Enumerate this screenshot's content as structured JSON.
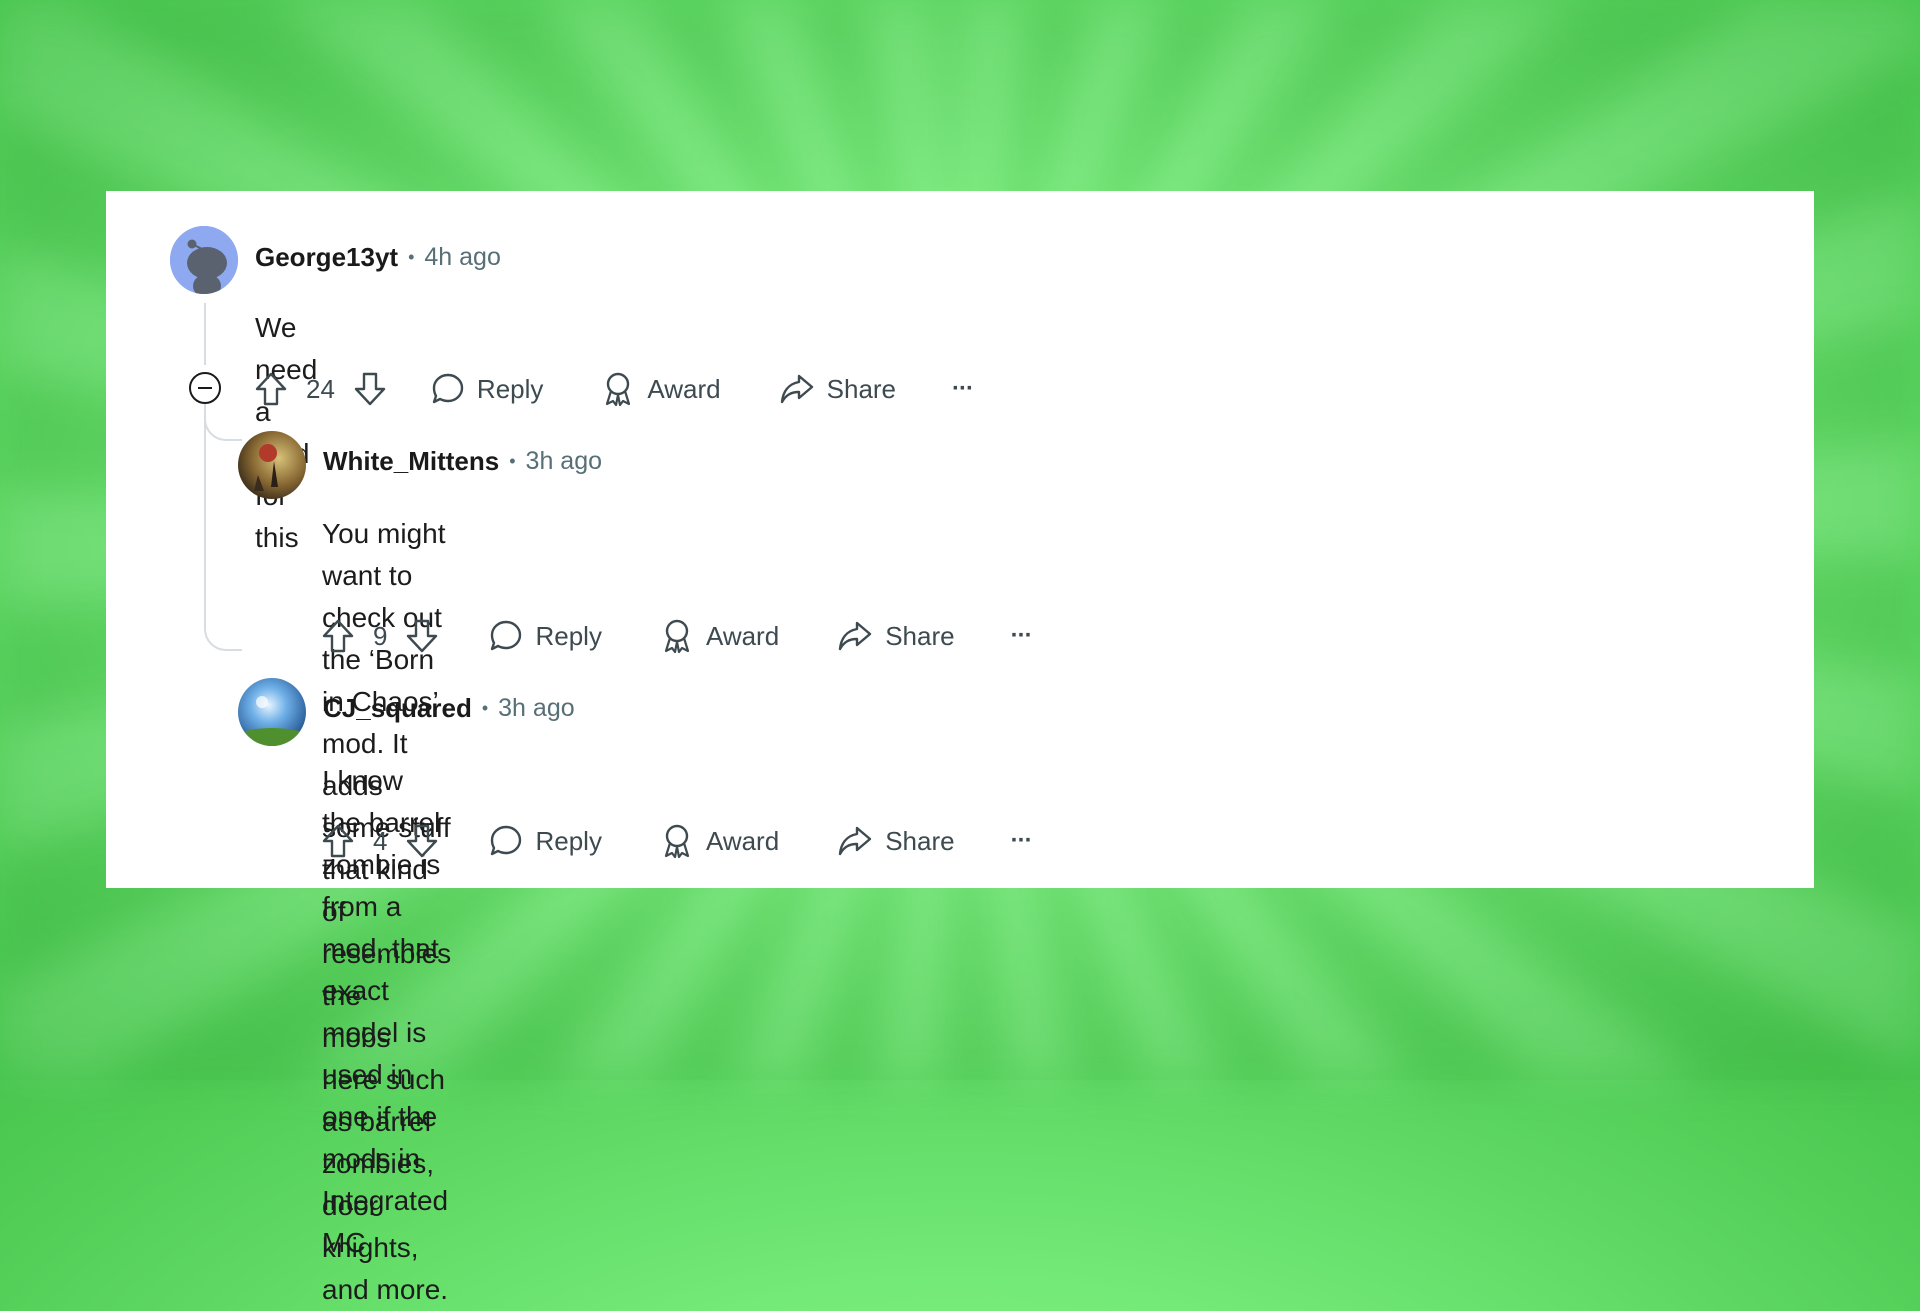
{
  "comments": [
    {
      "username": "George13yt",
      "separator": "•",
      "time": "4h ago",
      "text": "We need a mod for this",
      "votes": "24",
      "reply_label": "Reply",
      "award_label": "Award",
      "share_label": "Share",
      "more_label": "···",
      "avatar_color": "#8fa9f0"
    },
    {
      "username": "White_Mittens",
      "separator": "•",
      "time": "3h ago",
      "text_line1": "You might want to check out the ‘Born in Chaos’ mod. It adds some stuff that kind of resembles the",
      "text_line2": "mobs here such as barrel zombies, door knights, and more.",
      "votes": "9",
      "reply_label": "Reply",
      "award_label": "Award",
      "share_label": "Share",
      "more_label": "···"
    },
    {
      "username": "CJ_squared",
      "separator": "•",
      "time": "3h ago",
      "text": "I know the barrel zombie is from a mod, that exact model is used in one if the mods in Integrated MC",
      "votes": "4",
      "reply_label": "Reply",
      "award_label": "Award",
      "share_label": "Share",
      "more_label": "···"
    }
  ],
  "icons": [
    "upvote-icon",
    "downvote-icon",
    "reply-icon",
    "award-icon",
    "share-icon",
    "more-icon",
    "collapse-icon"
  ],
  "colors": {
    "background_green": "#74ea78",
    "card": "#ffffff",
    "meta_gray": "#576f76",
    "thread_line": "#d7dde0"
  }
}
